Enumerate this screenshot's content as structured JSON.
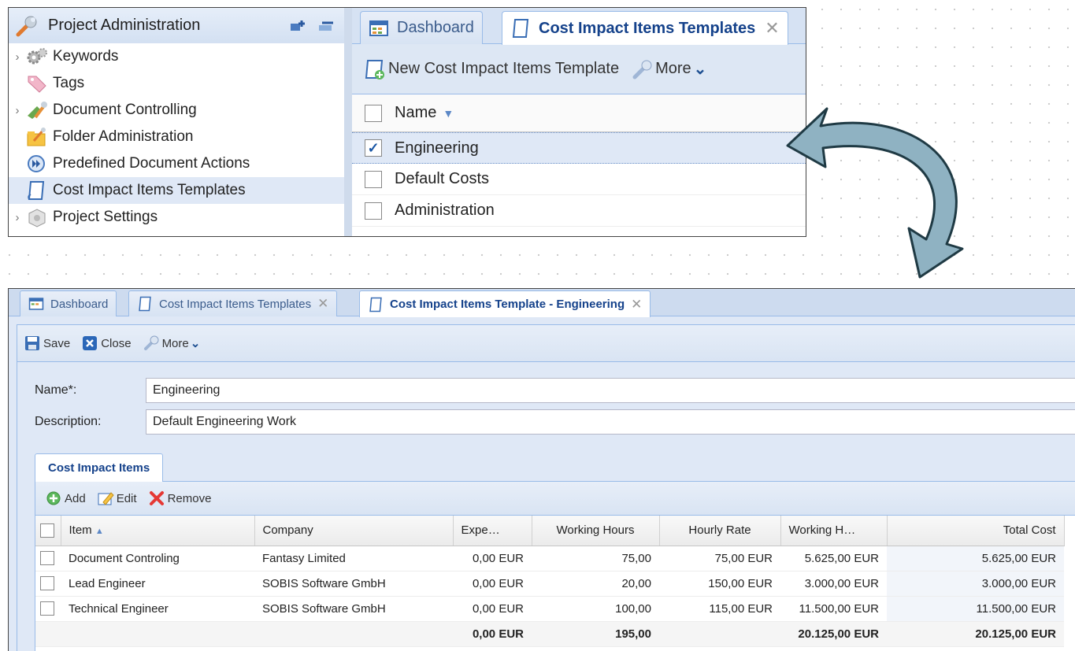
{
  "top": {
    "tree": {
      "title": "Project Administration",
      "items": [
        {
          "label": "Keywords",
          "icon": "gear-icon",
          "expandable": true
        },
        {
          "label": "Tags",
          "icon": "tag-icon",
          "expandable": false
        },
        {
          "label": "Document Controlling",
          "icon": "document-controlling-icon",
          "expandable": true
        },
        {
          "label": "Folder Administration",
          "icon": "folder-admin-icon",
          "expandable": false
        },
        {
          "label": "Predefined Document Actions",
          "icon": "fast-forward-icon",
          "expandable": false
        },
        {
          "label": "Cost Impact Items Templates",
          "icon": "template-icon",
          "expandable": false,
          "selected": true
        },
        {
          "label": "Project Settings",
          "icon": "settings-box-icon",
          "expandable": true
        }
      ]
    },
    "tabs": [
      {
        "label": "Dashboard",
        "active": false
      },
      {
        "label": "Cost Impact Items Templates",
        "active": true,
        "closable": true
      }
    ],
    "toolbar": {
      "new_label": "New Cost Impact Items Template",
      "more_label": "More"
    },
    "grid": {
      "header": "Name",
      "rows": [
        {
          "name": "Engineering",
          "checked": true
        },
        {
          "name": "Default Costs",
          "checked": false
        },
        {
          "name": "Administration",
          "checked": false
        }
      ]
    }
  },
  "bottom": {
    "tabs": [
      {
        "label": "Dashboard"
      },
      {
        "label": "Cost Impact Items Templates"
      },
      {
        "label": "Cost Impact Items Template - Engineering"
      }
    ],
    "toolbar": {
      "save_label": "Save",
      "close_label": "Close",
      "more_label": "More"
    },
    "form": {
      "name_label": "Name*:",
      "name_value": "Engineering",
      "description_label": "Description:",
      "description_value": "Default Engineering Work"
    },
    "section_tab": "Cost Impact Items",
    "grid_toolbar": {
      "add_label": "Add",
      "edit_label": "Edit",
      "remove_label": "Remove"
    },
    "columns": [
      "Item",
      "Company",
      "Expe…",
      "Working Hours",
      "Hourly Rate",
      "Working H…",
      "Total Cost"
    ],
    "rows": [
      {
        "item": "Document Controling",
        "company": "Fantasy Limited",
        "expenses": "0,00 EUR",
        "hours": "75,00",
        "rate": "75,00 EUR",
        "work_cost": "5.625,00 EUR",
        "total": "5.625,00 EUR"
      },
      {
        "item": "Lead Engineer",
        "company": "SOBIS Software GmbH",
        "expenses": "0,00 EUR",
        "hours": "20,00",
        "rate": "150,00 EUR",
        "work_cost": "3.000,00 EUR",
        "total": "3.000,00 EUR"
      },
      {
        "item": "Technical Engineer",
        "company": "SOBIS Software GmbH",
        "expenses": "0,00 EUR",
        "hours": "100,00",
        "rate": "115,00 EUR",
        "work_cost": "11.500,00 EUR",
        "total": "11.500,00 EUR"
      }
    ],
    "totals": {
      "expenses": "0,00 EUR",
      "hours": "195,00",
      "work_cost": "20.125,00 EUR",
      "total": "20.125,00 EUR"
    }
  },
  "colors": {
    "accent": "#15428b",
    "selection": "#dfe8f6",
    "arrow_fill": "#8fb2c2",
    "header_bg": "#d6e2f3"
  }
}
